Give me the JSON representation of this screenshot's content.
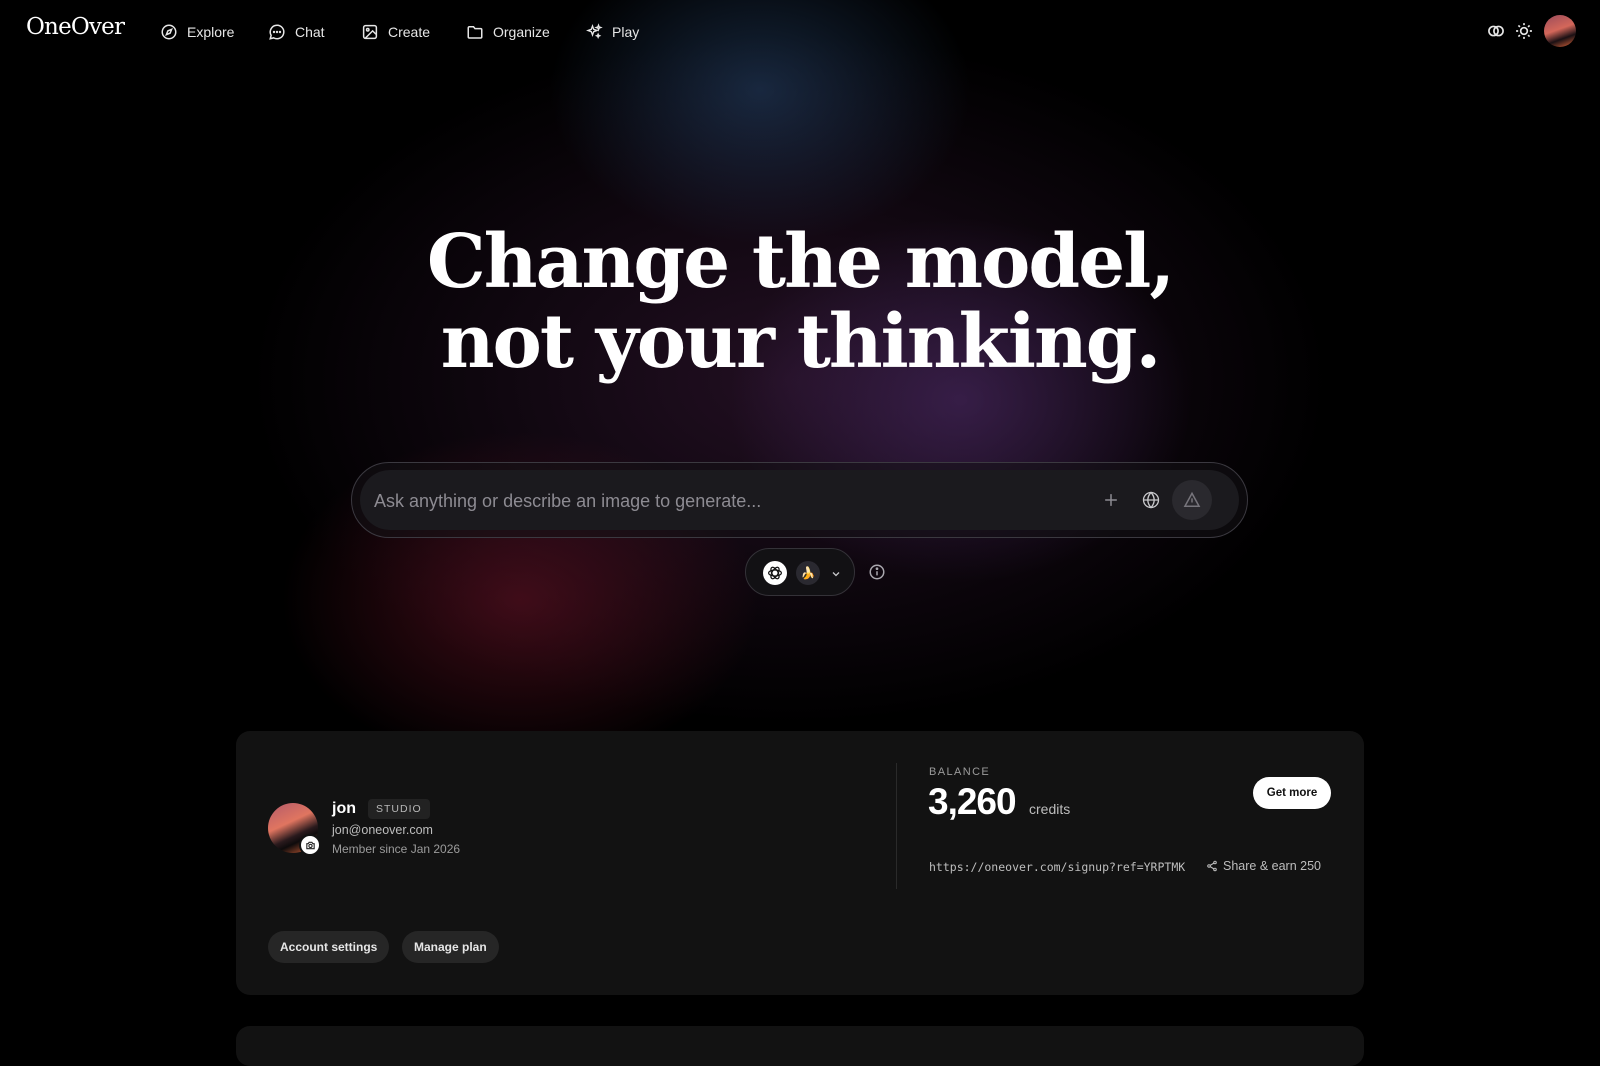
{
  "nav": {
    "logo": "OneOver",
    "items": [
      {
        "label": "Explore",
        "icon": "compass-icon"
      },
      {
        "label": "Chat",
        "icon": "chat-bubble-icon"
      },
      {
        "label": "Create",
        "icon": "image-icon"
      },
      {
        "label": "Organize",
        "icon": "folder-icon"
      },
      {
        "label": "Play",
        "icon": "sparkles-icon"
      }
    ],
    "right_icons": [
      "overlap-circles-icon",
      "sun-icon",
      "avatar"
    ]
  },
  "hero": {
    "line1": "Change the model,",
    "line2": "not your thinking."
  },
  "prompt": {
    "placeholder": "Ask anything or describe an image to generate..."
  },
  "model_selector": {
    "model_icon": "openai-logo-icon",
    "badge_icon": "banana-icon",
    "badge_glyph": "🍌"
  },
  "account": {
    "name": "jon",
    "tier": "STUDIO",
    "email": "jon@oneover.com",
    "member_since": "Member since Jan 2026",
    "balance_label": "BALANCE",
    "balance_value": "3,260",
    "balance_unit": "credits",
    "get_more": "Get more",
    "referral_link": "https://oneover.com/signup?ref=YRPTMK",
    "share_label": "Share & earn 250",
    "account_settings": "Account settings",
    "manage_plan": "Manage plan"
  },
  "colors": {
    "background": "#000000",
    "card": "#121212",
    "accent_text": "#ffffff"
  }
}
